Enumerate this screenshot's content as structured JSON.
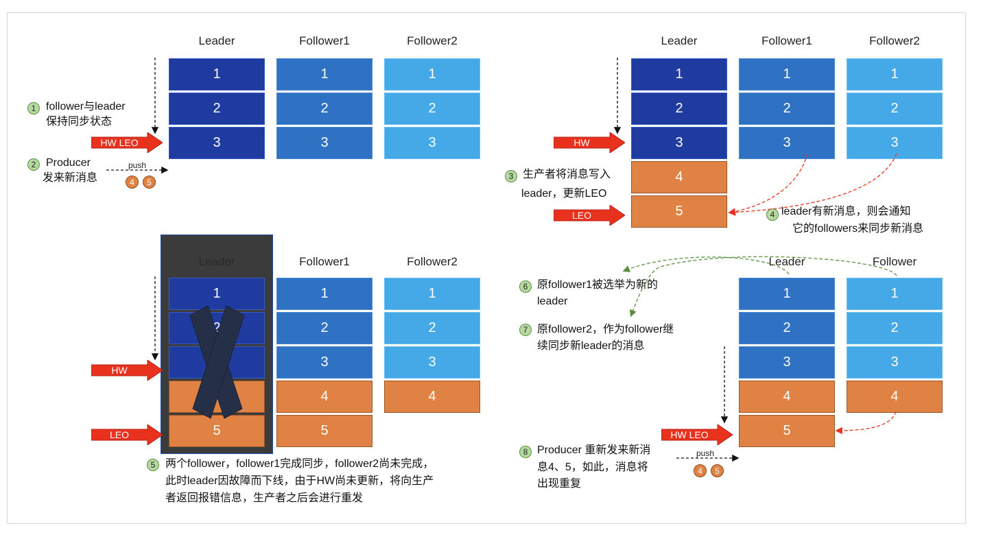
{
  "panel1": {
    "headers": [
      "Leader",
      "Follower1",
      "Follower2"
    ],
    "leader": [
      "1",
      "2",
      "3"
    ],
    "follower1": [
      "1",
      "2",
      "3"
    ],
    "follower2": [
      "1",
      "2",
      "3"
    ],
    "hw_leo_label": "HW  LEO",
    "step1": {
      "badge": "1",
      "line1": "follower与leader",
      "line2": "保持同步状态"
    },
    "step2": {
      "badge": "2",
      "line1": "Producer",
      "line2": "发来新消息"
    },
    "push_label": "push",
    "msg_badges": [
      "4",
      "5"
    ]
  },
  "panel2": {
    "headers": [
      "Leader",
      "Follower1",
      "Follower2"
    ],
    "leader": [
      "1",
      "2",
      "3",
      "4",
      "5"
    ],
    "follower1": [
      "1",
      "2",
      "3"
    ],
    "follower2": [
      "1",
      "2",
      "3"
    ],
    "hw_label": "HW",
    "leo_label": "LEO",
    "step3": {
      "badge": "3",
      "line1": "生产者将消息写入",
      "line2": "leader，更新LEO"
    },
    "step4": {
      "badge": "4",
      "line1": "leader有新消息，则会通知",
      "line2": "它的followers来同步新消息"
    }
  },
  "panel3": {
    "headers": [
      "Leader",
      "Follower1",
      "Follower2"
    ],
    "leader": [
      "1",
      "2",
      "3",
      "4",
      "5"
    ],
    "follower1": [
      "1",
      "2",
      "3",
      "4",
      "5"
    ],
    "follower2": [
      "1",
      "2",
      "3",
      "4"
    ],
    "hw_label": "HW",
    "leo_label": "LEO",
    "step5": {
      "badge": "5",
      "line1": "两个follower，follower1完成同步，follower2尚未完成，",
      "line2": "此时leader因故障而下线，由于HW尚未更新，将向生产",
      "line3": "者返回报错信息，生产者之后会进行重发"
    }
  },
  "panel4": {
    "headers": [
      "Leader",
      "Follower"
    ],
    "leader": [
      "1",
      "2",
      "3",
      "4",
      "5"
    ],
    "follower": [
      "1",
      "2",
      "3",
      "4"
    ],
    "hw_leo_label": "HW  LEO",
    "step6": {
      "badge": "6",
      "line1": "原follower1被选举为新的",
      "line2": "leader"
    },
    "step7": {
      "badge": "7",
      "line1": "原follower2，作为follower继",
      "line2": "续同步新leader的消息"
    },
    "step8": {
      "badge": "8",
      "line1": "Producer 重新发来新消",
      "line2": "息4、5，如此，消息将",
      "line3": "出现重复"
    },
    "push_label": "push",
    "msg_badges": [
      "4",
      "5"
    ]
  },
  "colors": {
    "leader_block": "#203ba0",
    "follower1_block": "#2f72c4",
    "follower2_block": "#45a9e8",
    "new_message_block": "#e08243",
    "pointer_arrow": "#e8321e",
    "sync_arrow": "#e8321e",
    "election_arrow": "#5b8f3f",
    "failed_overlay": "#3c3b3b"
  }
}
